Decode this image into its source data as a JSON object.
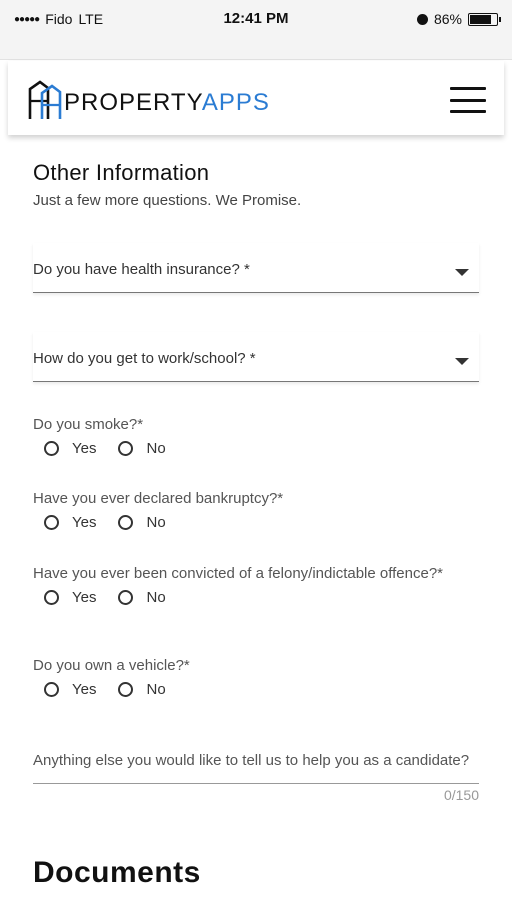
{
  "status_bar": {
    "signal": "●●●●●",
    "carrier": "Fido",
    "network": "LTE",
    "time": "12:41 PM",
    "alarm_icon": "alarm-icon",
    "battery": "86%",
    "battery_level": 0.86
  },
  "header": {
    "logo_part1": "PROPERTY",
    "logo_part2": "APPS",
    "brand_color": "#2b7cd3",
    "menu_icon": "hamburger-menu-icon"
  },
  "other_info": {
    "title": "Other Information",
    "subtitle": "Just a few more questions. We Promise."
  },
  "selects": [
    {
      "label": "Do you have health insurance? *"
    },
    {
      "label": "How do you get to work/school? *"
    }
  ],
  "questions": [
    {
      "label": "Do you smoke?*",
      "options": [
        "Yes",
        "No"
      ]
    },
    {
      "label": "Have you ever declared bankruptcy?*",
      "options": [
        "Yes",
        "No"
      ]
    },
    {
      "label": "Have you ever been convicted of a felony/indictable offence?*",
      "options": [
        "Yes",
        "No"
      ]
    },
    {
      "label": "Do you own a vehicle?*",
      "options": [
        "Yes",
        "No"
      ]
    }
  ],
  "comments": {
    "placeholder": "Anything else you would like to tell us to help you as a candidate?",
    "counter": "0/150"
  },
  "documents": {
    "title": "Documents"
  }
}
